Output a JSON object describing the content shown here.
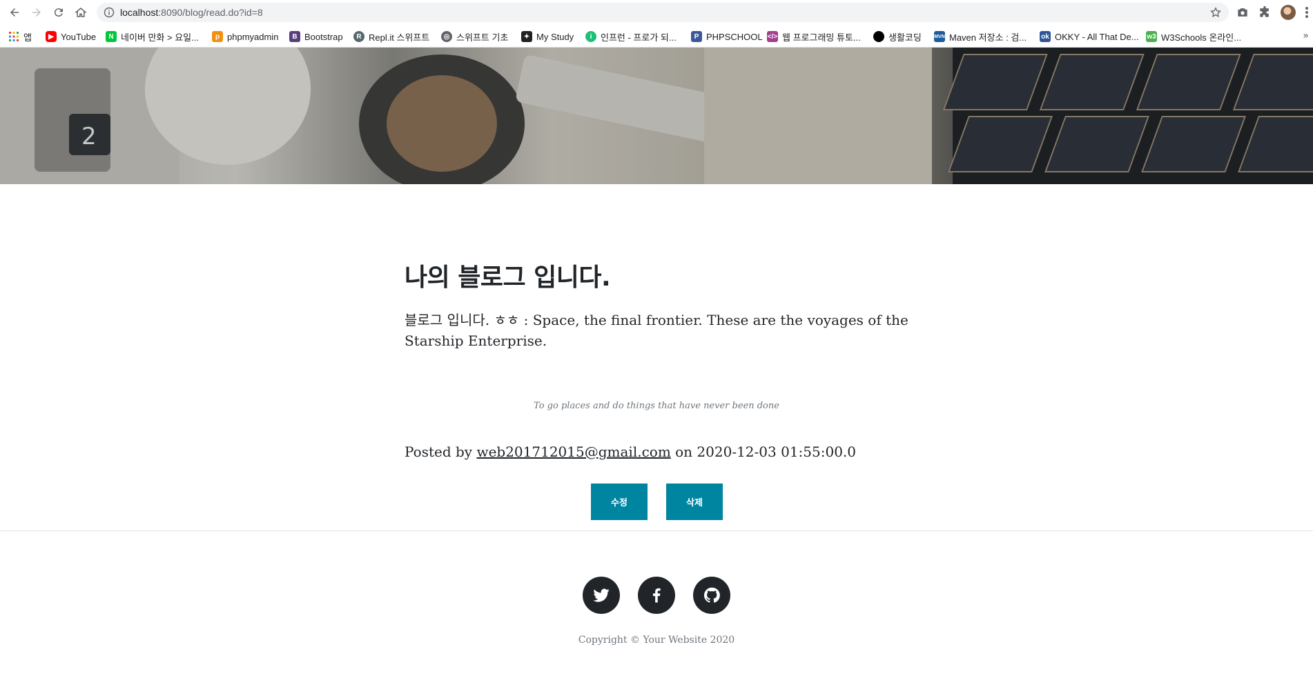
{
  "browser": {
    "url_host": "localhost",
    "url_rest": ":8090/blog/read.do?id=8",
    "bookmarks": [
      {
        "label": "앱",
        "icon": "apps-grid-icon"
      },
      {
        "label": "YouTube",
        "icon": "youtube-icon"
      },
      {
        "label": "네이버 만화 > 요일...",
        "icon": "naver-webtoon-icon"
      },
      {
        "label": "phpmyadmin",
        "icon": "phpmyadmin-icon"
      },
      {
        "label": "Bootstrap",
        "icon": "bootstrap-icon"
      },
      {
        "label": "Repl.it 스위프트",
        "icon": "replit-icon"
      },
      {
        "label": "스위프트 기초",
        "icon": "globe-icon"
      },
      {
        "label": "My Study",
        "icon": "mystudy-icon"
      },
      {
        "label": "인프런 - 프로가 되...",
        "icon": "inflearn-icon"
      },
      {
        "label": "PHPSCHOOL",
        "icon": "phpschool-icon"
      },
      {
        "label": "웹 프로그래밍 튜토...",
        "icon": "code-icon"
      },
      {
        "label": "생활코딩",
        "icon": "opentutorials-icon"
      },
      {
        "label": "Maven 저장소 : 검...",
        "icon": "maven-icon"
      },
      {
        "label": "OKKY - All That De...",
        "icon": "okky-icon"
      },
      {
        "label": "W3Schools 온라인...",
        "icon": "w3schools-icon"
      }
    ],
    "more": "»"
  },
  "post": {
    "title": "나의 블로그 입니다.",
    "body": "블로그 입니다. ㅎㅎ : Space, the final frontier. These are the voyages of the Starship Enterprise.",
    "quote": "To go places and do things that have never been done",
    "meta_prefix": "Posted by",
    "author": "web201712015@gmail.com",
    "meta_mid": "on",
    "date": "2020-12-03 01:55:00.0",
    "edit_label": "수정",
    "delete_label": "삭제"
  },
  "footer": {
    "social": [
      "twitter-icon",
      "facebook-icon",
      "github-icon"
    ],
    "copyright": "Copyright © Your Website 2020"
  },
  "colors": {
    "accent": "#0085a1",
    "text": "#212529",
    "muted": "#6c757d"
  }
}
